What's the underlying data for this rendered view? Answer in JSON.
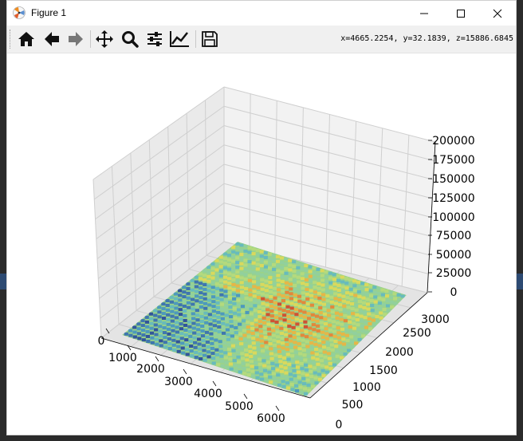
{
  "window": {
    "title": "Figure 1"
  },
  "toolbar": {
    "buttons": [
      {
        "name": "home-icon",
        "tooltip": "Reset original view"
      },
      {
        "name": "back-arrow-icon",
        "tooltip": "Back"
      },
      {
        "name": "forward-arrow-icon",
        "tooltip": "Forward"
      },
      {
        "name": "pan-icon",
        "tooltip": "Pan"
      },
      {
        "name": "zoom-icon",
        "tooltip": "Zoom"
      },
      {
        "name": "configure-subplots-icon",
        "tooltip": "Configure subplots"
      },
      {
        "name": "edit-axis-icon",
        "tooltip": "Edit axis"
      },
      {
        "name": "save-icon",
        "tooltip": "Save"
      }
    ],
    "coords": "x=4665.2254, y=32.1839, z=15886.6845"
  },
  "chart_data": {
    "type": "surface",
    "x_ticks": [
      "0",
      "1000",
      "2000",
      "3000",
      "4000",
      "5000",
      "6000"
    ],
    "y_ticks": [
      "0",
      "500",
      "1000",
      "1500",
      "2000",
      "2500",
      "3000"
    ],
    "z_ticks": [
      "0",
      "25000",
      "50000",
      "75000",
      "100000",
      "125000",
      "150000",
      "175000",
      "200000"
    ],
    "xlim": [
      0,
      6300
    ],
    "ylim": [
      0,
      3300
    ],
    "zlim": [
      0,
      200000
    ],
    "colormap": "jet",
    "grid": true
  }
}
